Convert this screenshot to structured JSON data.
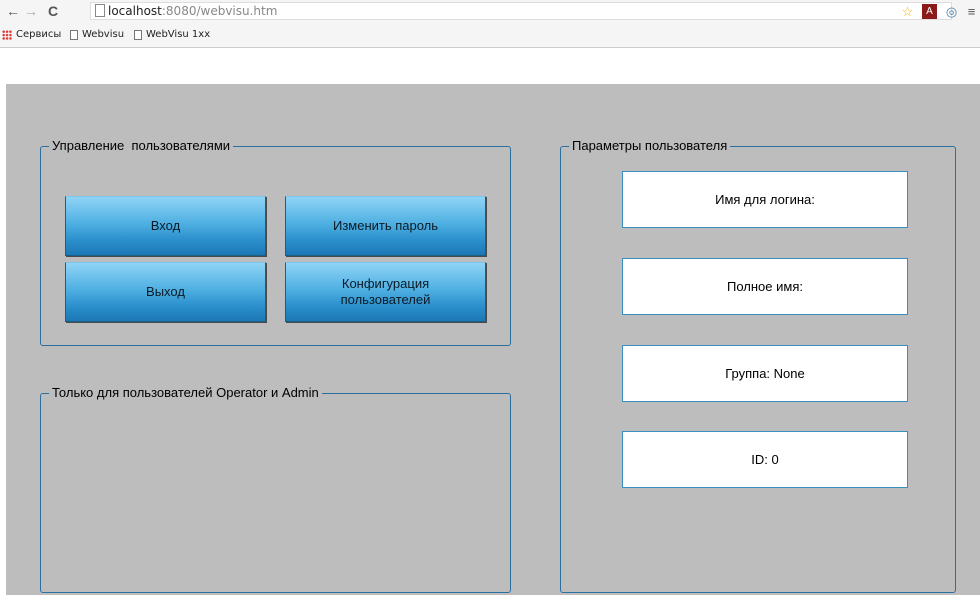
{
  "browser": {
    "nav": {
      "back": "←",
      "forward": "→",
      "reload": "C"
    },
    "url_host": "localhost",
    "url_path": ":8080/webvisu.htm",
    "bookmarks": [
      {
        "label": "Сервисы"
      },
      {
        "label": "Webvisu"
      },
      {
        "label": "WebVisu 1xx"
      }
    ]
  },
  "visu": {
    "user_management": {
      "title": "Управление  пользователями",
      "login_label": "Вход",
      "change_password_label": "Изменить пароль",
      "logout_label": "Выход",
      "user_config_line1": "Конфигурация",
      "user_config_line2": "пользователей"
    },
    "restricted": {
      "title": "Только для пользователей Operator и Admin"
    },
    "user_params": {
      "title": "Параметры пользователя",
      "login_name": "Имя для логина:",
      "full_name": "Полное имя:",
      "group": "Группа: None",
      "id": "ID: 0"
    }
  },
  "colors": {
    "canvas": "#bdbdbd",
    "frame": "#2b6f9e",
    "button_top": "#8fd4f6",
    "button_bottom": "#1c77b4"
  }
}
